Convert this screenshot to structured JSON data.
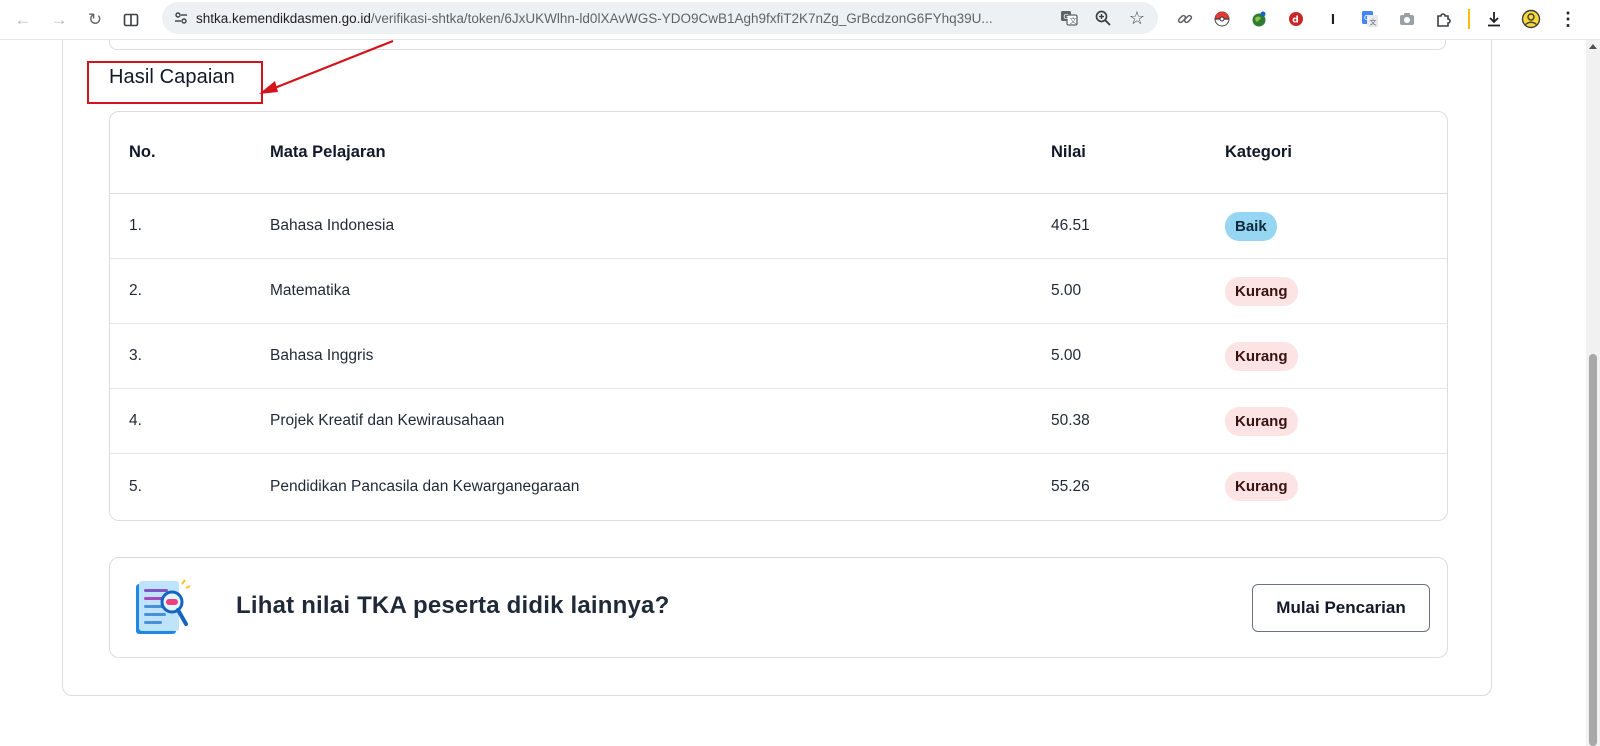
{
  "browser": {
    "url_host": "shtka.kemendikdasmen.go.id",
    "url_path": "/verifikasi-shtka/token/6JxUKWlhn-ld0lXAvWGS-YDO9CwB1Agh9fxfiT2K7nZg_GrBcdzonG6FYhq39U..."
  },
  "section": {
    "title": "Hasil Capaian"
  },
  "table": {
    "headers": {
      "no": "No.",
      "subject": "Mata Pelajaran",
      "score": "Nilai",
      "category": "Kategori"
    },
    "rows": [
      {
        "no": "1.",
        "subject": "Bahasa Indonesia",
        "score": "46.51",
        "category": "Baik",
        "level": "baik"
      },
      {
        "no": "2.",
        "subject": "Matematika",
        "score": "5.00",
        "category": "Kurang",
        "level": "kurang"
      },
      {
        "no": "3.",
        "subject": "Bahasa Inggris",
        "score": "5.00",
        "category": "Kurang",
        "level": "kurang"
      },
      {
        "no": "4.",
        "subject": "Projek Kreatif dan Kewirausahaan",
        "score": "50.38",
        "category": "Kurang",
        "level": "kurang"
      },
      {
        "no": "5.",
        "subject": "Pendidikan Pancasila dan Kewarganegaraan",
        "score": "55.26",
        "category": "Kurang",
        "level": "kurang"
      }
    ]
  },
  "cta": {
    "text": "Lihat nilai TKA peserta didik lainnya?",
    "button_label": "Mulai Pencarian"
  },
  "colors": {
    "badge_baik": "#97d6f3",
    "badge_kurang": "#fde4e4",
    "annotation": "#d3141c"
  }
}
